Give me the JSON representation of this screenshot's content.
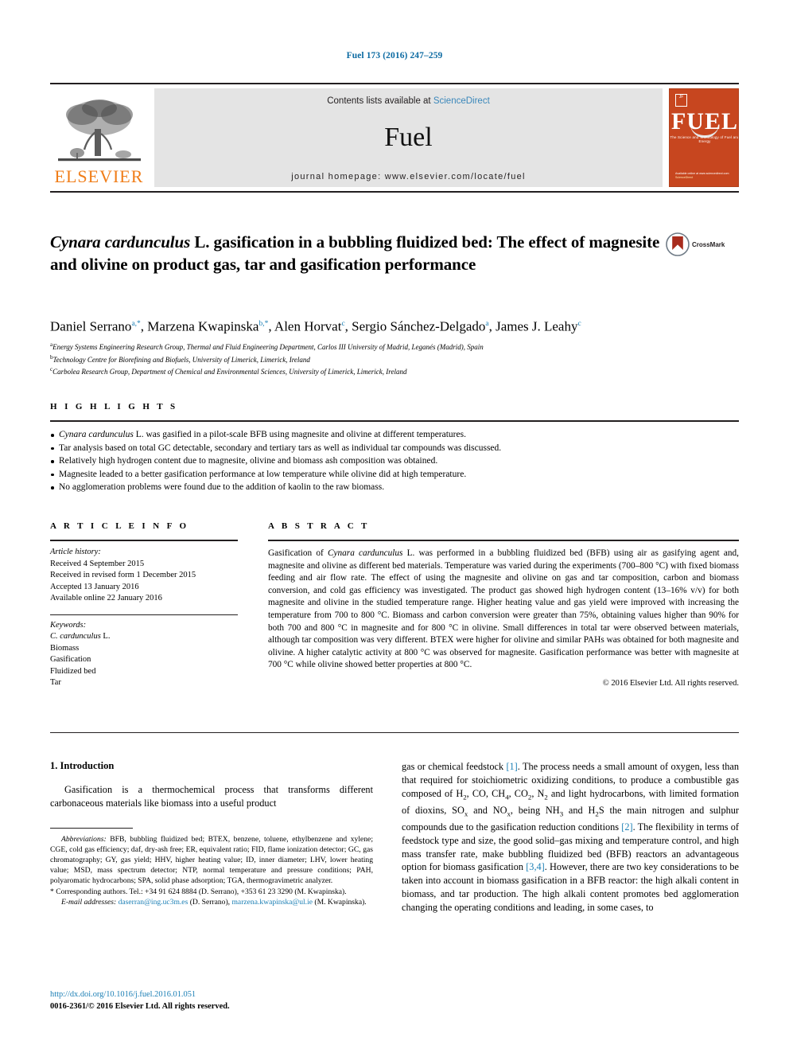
{
  "running_head": "Fuel 173 (2016) 247–259",
  "masthead": {
    "publisher": "ELSEVIER",
    "contents_prefix": "Contents lists available at ",
    "contents_link": "ScienceDirect",
    "journal_name": "Fuel",
    "homepage": "journal homepage: www.elsevier.com/locate/fuel",
    "cover": {
      "badge": "JF",
      "title": "FUEL",
      "subtitle": "The Science and Technology of Fuel and Energy",
      "footer_line1": "Available online at www.sciencedirect.com",
      "footer_line2": "ScienceDirect"
    }
  },
  "article": {
    "title_part1": "Cynara cardunculus",
    "title_part2": " L. gasification in a bubbling fluidized bed: The effect of magnesite and olivine on product gas, tar and gasification performance",
    "crossmark_label": "CrossMark",
    "authors": [
      {
        "name": "Daniel Serrano",
        "marks": "a,*",
        "sep": ", "
      },
      {
        "name": "Marzena Kwapinska",
        "marks": "b,*",
        "sep": ", "
      },
      {
        "name": "Alen Horvat",
        "marks": "c",
        "sep": ", "
      },
      {
        "name": "Sergio Sánchez-Delgado",
        "marks": "a",
        "sep": ", "
      },
      {
        "name": "James J. Leahy",
        "marks": "c",
        "sep": ""
      }
    ],
    "affiliations": [
      {
        "mark": "a",
        "text": "Energy Systems Engineering Research Group, Thermal and Fluid Engineering Department, Carlos III University of Madrid, Leganés (Madrid), Spain"
      },
      {
        "mark": "b",
        "text": "Technology Centre for Biorefining and Biofuels, University of Limerick, Limerick, Ireland"
      },
      {
        "mark": "c",
        "text": "Carbolea Research Group, Department of Chemical and Environmental Sciences, University of Limerick, Limerick, Ireland"
      }
    ]
  },
  "highlights": {
    "heading": "H I G H L I G H T S",
    "items": [
      {
        "italic": "Cynara cardunculus",
        "rest": " L. was gasified in a pilot-scale BFB using magnesite and olivine at different temperatures."
      },
      {
        "italic": "",
        "rest": "Tar analysis based on total GC detectable, secondary and tertiary tars as well as individual tar compounds was discussed."
      },
      {
        "italic": "",
        "rest": "Relatively high hydrogen content due to magnesite, olivine and biomass ash composition was obtained."
      },
      {
        "italic": "",
        "rest": "Magnesite leaded to a better gasification performance at low temperature while olivine did at high temperature."
      },
      {
        "italic": "",
        "rest": "No agglomeration problems were found due to the addition of kaolin to the raw biomass."
      }
    ]
  },
  "article_info": {
    "heading": "A R T I C L E    I N F O",
    "history_label": "Article history:",
    "history": [
      "Received 4 September 2015",
      "Received in revised form 1 December 2015",
      "Accepted 13 January 2016",
      "Available online 22 January 2016"
    ],
    "keywords_label": "Keywords:",
    "keywords": [
      {
        "italic": "C. cardunculus",
        "rest": " L."
      },
      {
        "italic": "",
        "rest": "Biomass"
      },
      {
        "italic": "",
        "rest": "Gasification"
      },
      {
        "italic": "",
        "rest": "Fluidized bed"
      },
      {
        "italic": "",
        "rest": "Tar"
      }
    ]
  },
  "abstract": {
    "heading": "A B S T R A C T",
    "lead": "Gasification of ",
    "species": "Cynara cardunculus",
    "text": " L. was performed in a bubbling fluidized bed (BFB) using air as gasifying agent and, magnesite and olivine as different bed materials. Temperature was varied during the experiments (700–800 °C) with fixed biomass feeding and air flow rate. The effect of using the magnesite and olivine on gas and tar composition, carbon and biomass conversion, and cold gas efficiency was investigated. The product gas showed high hydrogen content (13–16% v/v) for both magnesite and olivine in the studied temperature range. Higher heating value and gas yield were improved with increasing the temperature from 700 to 800 °C. Biomass and carbon conversion were greater than 75%, obtaining values higher than 90% for both 700 and 800 °C in magnesite and for 800 °C in olivine. Small differences in total tar were observed between materials, although tar composition was very different. BTEX were higher for olivine and similar PAHs was obtained for both magnesite and olivine. A higher catalytic activity at 800 °C was observed for magnesite. Gasification performance was better with magnesite at 700 °C while olivine showed better properties at 800 °C.",
    "copyright": "© 2016 Elsevier Ltd. All rights reserved."
  },
  "introduction": {
    "heading": "1. Introduction",
    "left_paragraph": "Gasification is a thermochemical process that transforms different carbonaceous materials like biomass into a useful product",
    "right_paragraph_1a": "gas or chemical feedstock ",
    "right_ref_1": "[1]",
    "right_paragraph_1b": ". The process needs a small amount of oxygen, less than that required for stoichiometric oxidizing conditions, to produce a combustible gas composed of H",
    "right_chem_1": "2, CO, CH4, CO2, N2",
    "right_paragraph_1c": " and light hydrocarbons, with limited formation of dioxins, SOx and NOx, being NH3 and H2S the main nitrogen and sulphur compounds due to the gasification reduction conditions ",
    "right_ref_2": "[2]",
    "right_paragraph_1d": ". The flexibility in terms of feedstock type and size, the good solid–gas mixing and temperature control, and high mass transfer rate, make bubbling fluidized bed (BFB) reactors an advantageous option for biomass gasification ",
    "right_ref_3": "[3,4]",
    "right_paragraph_1e": ". However, there are two key considerations to be taken into account in biomass gasification in a BFB reactor: the high alkali content in biomass, and tar production. The high alkali content promotes bed agglomeration changing the operating conditions and leading, in some cases, to"
  },
  "footnotes": {
    "abbrev_label": "Abbreviations:",
    "abbrev_text": " BFB, bubbling fluidized bed; BTEX, benzene, toluene, ethylbenzene and xylene; CGE, cold gas efficiency; daf, dry-ash free; ER, equivalent ratio; FID, flame ionization detector; GC, gas chromatography; GY, gas yield; HHV, higher heating value; ID, inner diameter; LHV, lower heating value; MSD, mass spectrum detector; NTP, normal temperature and pressure conditions; PAH, polyaromatic hydrocarbons; SPA, solid phase adsorption; TGA, thermogravimetric analyzer.",
    "corresponding": "* Corresponding authors. Tel.: +34 91 624 8884 (D. Serrano), +353 61 23 3290 (M. Kwapinska).",
    "email_label": "E-mail addresses:",
    "email_1": "daserran@ing.uc3m.es",
    "email_1_owner": " (D. Serrano), ",
    "email_2": "marzena.kwapinska@ul.ie",
    "email_2_owner": " (M. Kwapinska)."
  },
  "doi_block": {
    "doi": "http://dx.doi.org/10.1016/j.fuel.2016.01.051",
    "issn": "0016-2361/© 2016 Elsevier Ltd. All rights reserved."
  },
  "colors": {
    "link": "#1b7fb5",
    "running_head": "#0b6aa2",
    "elsevier_orange": "#f07d18",
    "cover_orange": "#c7461f",
    "band_gray": "#e4e4e4"
  }
}
